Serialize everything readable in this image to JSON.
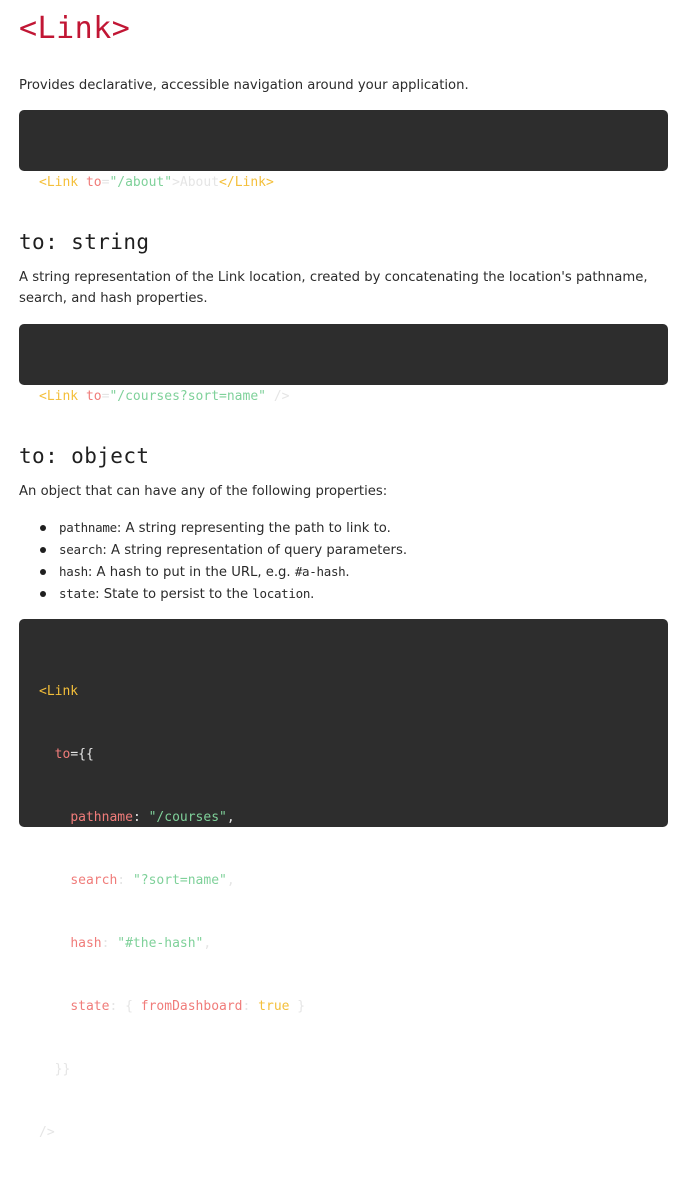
{
  "title": "<Link>",
  "intro": "Provides declarative, accessible navigation around your application.",
  "example1": {
    "open_tag": "<Link",
    "attr": " to",
    "eq": "=",
    "value": "\"/about\"",
    "close": ">",
    "text": "About",
    "end_tag": "</Link>"
  },
  "section_string": {
    "heading": "to: string",
    "description": "A string representation of the Link location, created by concatenating the location's pathname, search, and hash properties."
  },
  "example2": {
    "open_tag": "<Link",
    "attr": " to",
    "eq": "=",
    "value": "\"/courses?sort=name\"",
    "close": " />"
  },
  "section_object": {
    "heading": "to: object",
    "description": "An object that can have any of the following properties:",
    "properties": [
      {
        "name": "pathname",
        "sep": ": ",
        "text": "A string representing the path to link to.",
        "suffix_code": "",
        "suffix_text": ""
      },
      {
        "name": "search",
        "sep": ": ",
        "text": "A string representation of query parameters.",
        "suffix_code": "",
        "suffix_text": ""
      },
      {
        "name": "hash",
        "sep": ": ",
        "text": "A hash to put in the URL, e.g. ",
        "suffix_code": "#a-hash",
        "suffix_text": "."
      },
      {
        "name": "state",
        "sep": ": ",
        "text": "State to persist to the ",
        "suffix_code": "location",
        "suffix_text": "."
      }
    ]
  },
  "example3": {
    "l1_tag": "<Link",
    "l2_indent": "  ",
    "l2_attr": "to",
    "l2_rest": "={{",
    "l3_indent": "    ",
    "l3_key": "pathname",
    "l3_colon": ": ",
    "l3_val": "\"/courses\"",
    "l3_comma": ",",
    "l4_indent": "    ",
    "l4_key": "search",
    "l4_colon": ": ",
    "l4_val": "\"?sort=name\"",
    "l4_comma": ",",
    "l5_indent": "    ",
    "l5_key": "hash",
    "l5_colon": ": ",
    "l5_val": "\"#the-hash\"",
    "l5_comma": ",",
    "l6_indent": "    ",
    "l6_key": "state",
    "l6_colon": ": { ",
    "l6_inner_key": "fromDashboard",
    "l6_inner_colon": ": ",
    "l6_bool": "true",
    "l6_close": " }",
    "l7": "  }}",
    "l8": "/>"
  },
  "colors": {
    "title": "#c11634",
    "code_bg": "#2d2d2d",
    "tag": "#f4bf3a",
    "attr": "#f07c7a",
    "string": "#7fd19a"
  }
}
